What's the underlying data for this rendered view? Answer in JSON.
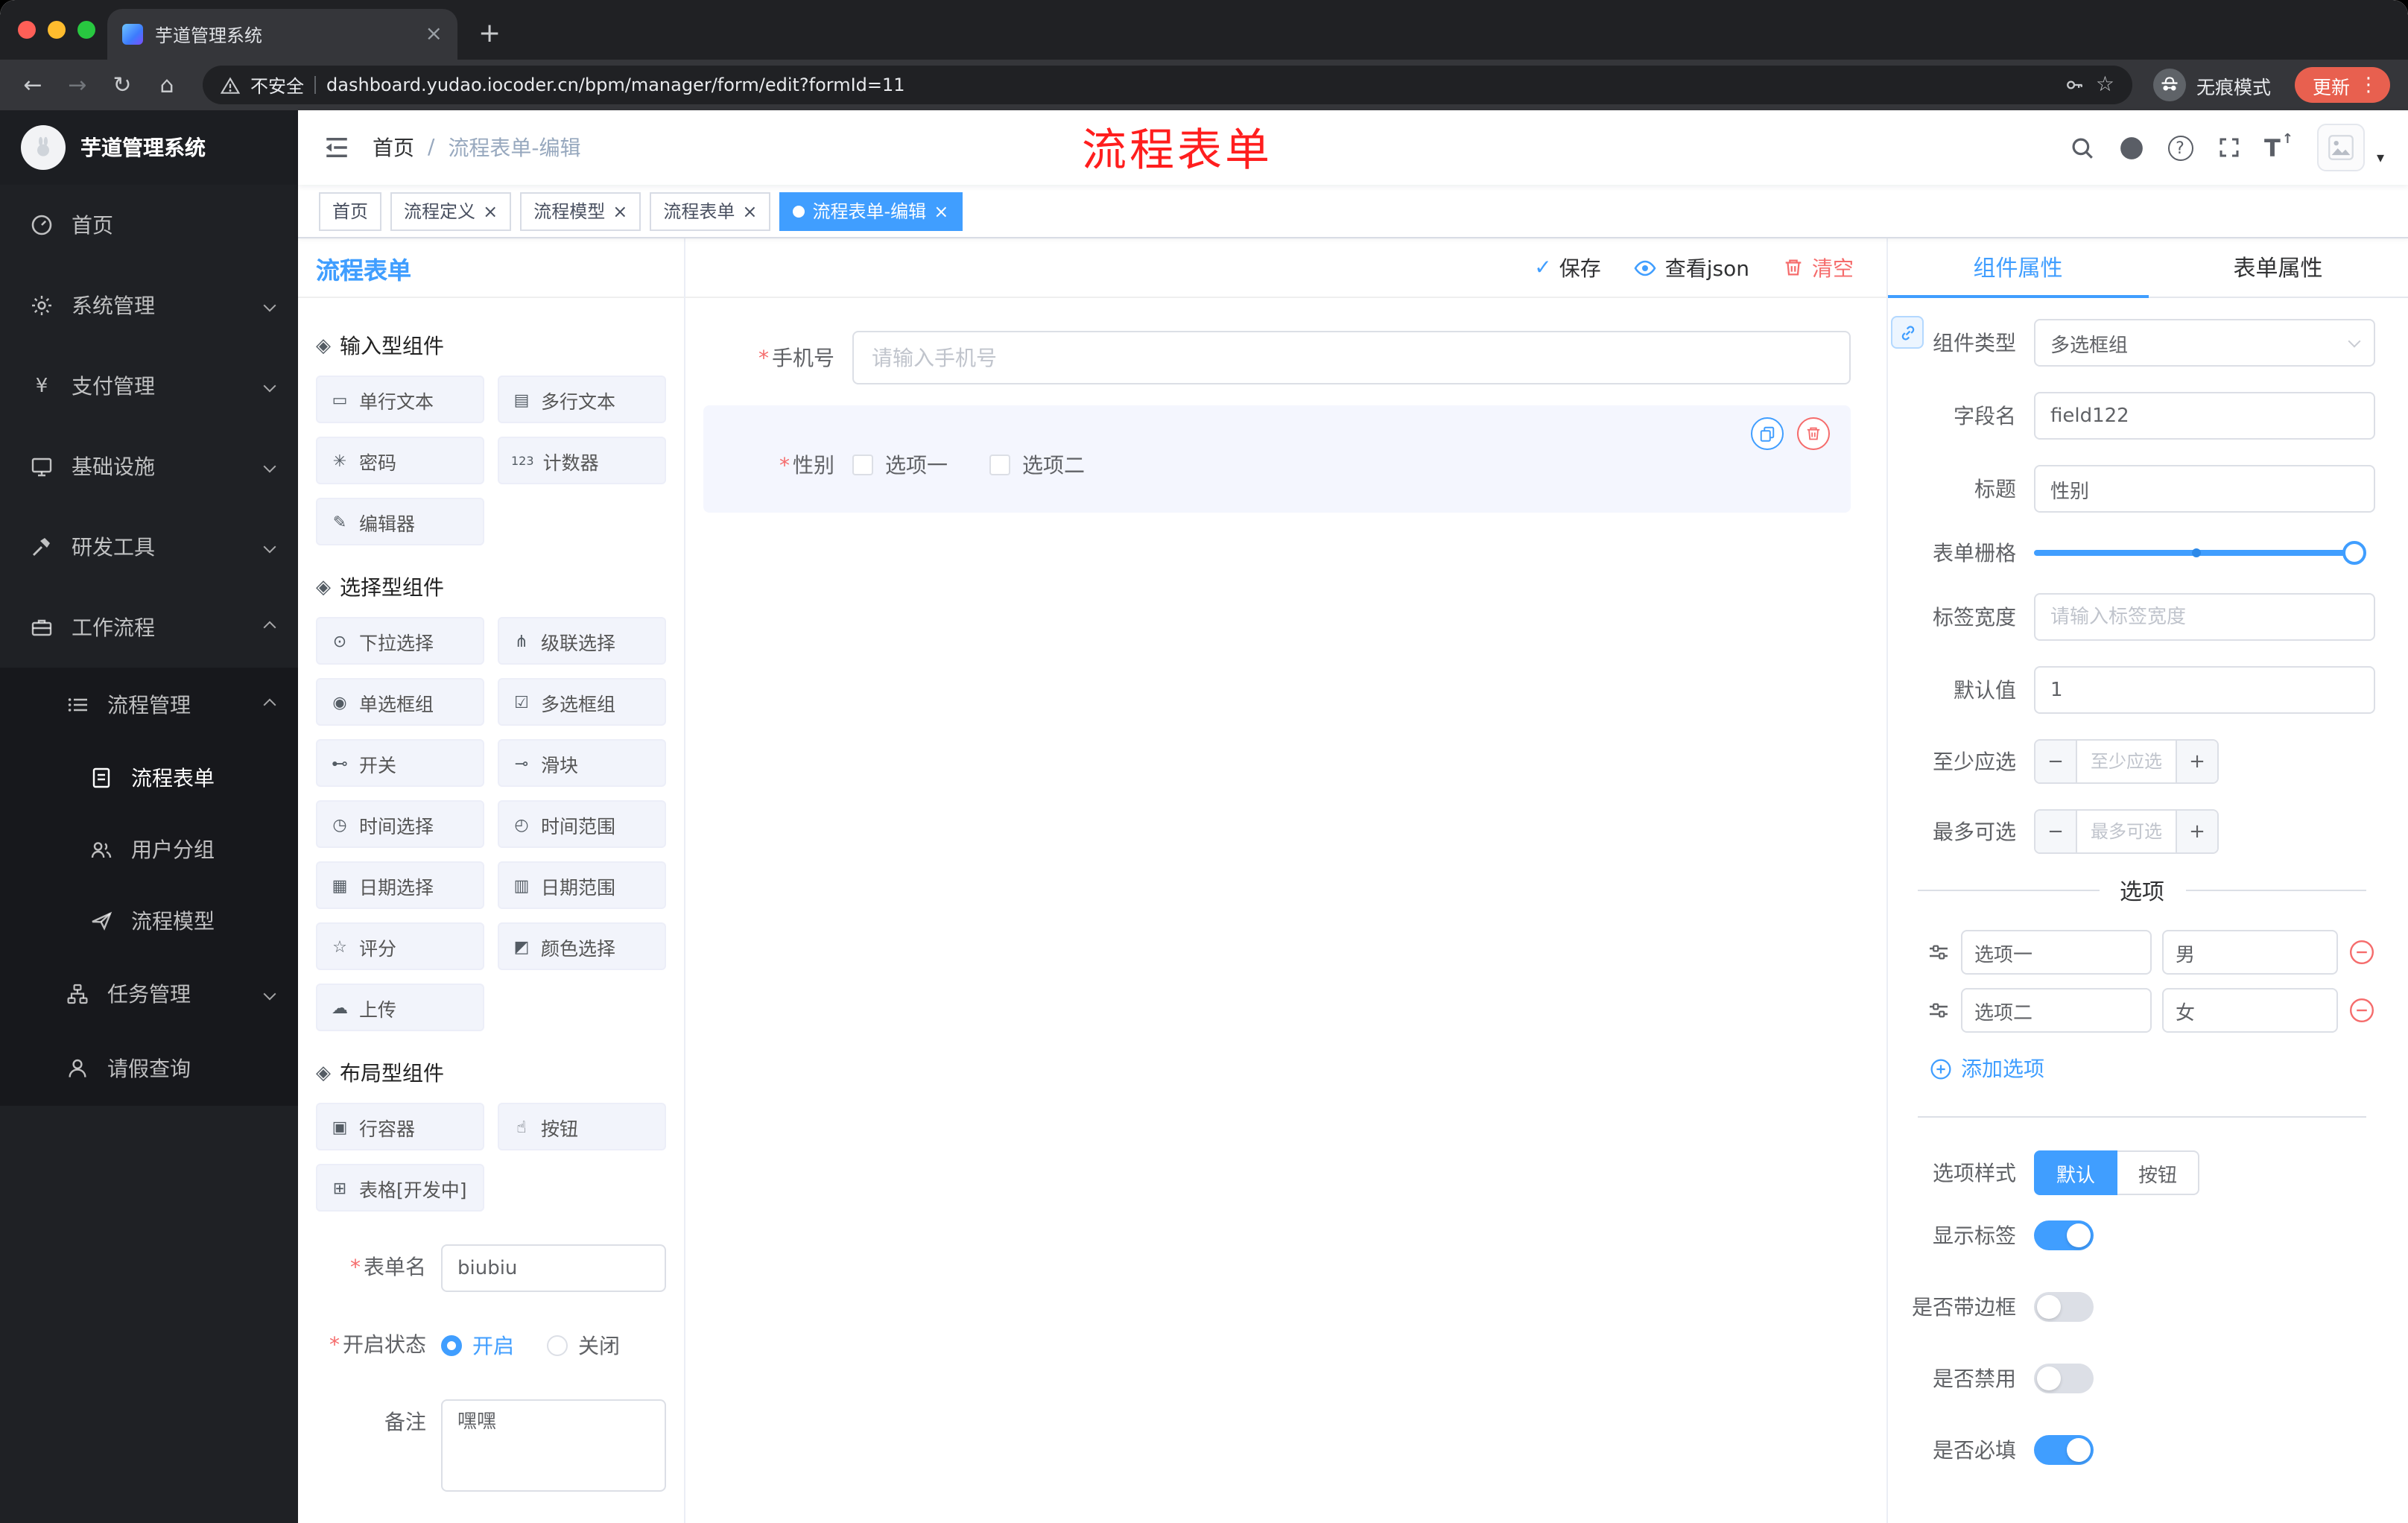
{
  "colors": {
    "primary": "#409eff",
    "danger": "#f56c6c",
    "sidebar_bg": "#1f2125",
    "annotation_red": "#ff1e1e",
    "update_chip": "#e8604f",
    "active_tag": "#409eff"
  },
  "icons": {
    "asterisk": "*",
    "close": "×",
    "plus": "+",
    "minus": "−",
    "dots": "⋮",
    "caret_down": "▾",
    "back": "←",
    "forward": "→",
    "reload": "↻",
    "home": "⌂",
    "star": "☆",
    "check": "✓",
    "question": "?",
    "text_size": "T",
    "up_arrow": "↑",
    "slash": "/"
  },
  "browser": {
    "tab_title": "芋道管理系统",
    "security_label": "不安全",
    "url": "dashboard.yudao.iocoder.cn/bpm/manager/form/edit?formId=11",
    "incognito_label": "无痕模式",
    "update_label": "更新"
  },
  "sidebar": {
    "brand": "芋道管理系统",
    "menu": {
      "home": "首页",
      "system": "系统管理",
      "payment": "支付管理",
      "infra": "基础设施",
      "devtools": "研发工具",
      "workflow": "工作流程",
      "process_mgmt": "流程管理",
      "process_form": "流程表单",
      "user_group": "用户分组",
      "process_model": "流程模型",
      "task_mgmt": "任务管理",
      "leave_query": "请假查询"
    }
  },
  "navbar": {
    "breadcrumb_home": "首页",
    "breadcrumb_current": "流程表单-编辑",
    "annotation": "流程表单"
  },
  "tags": [
    {
      "label": "首页",
      "active": false,
      "closable": false
    },
    {
      "label": "流程定义",
      "active": false,
      "closable": true
    },
    {
      "label": "流程模型",
      "active": false,
      "closable": true
    },
    {
      "label": "流程表单",
      "active": false,
      "closable": true
    },
    {
      "label": "流程表单-编辑",
      "active": true,
      "closable": true
    }
  ],
  "designer": {
    "panel_title": "流程表单",
    "toolbar": {
      "save": "保存",
      "view_json": "查看json",
      "clear": "清空"
    },
    "palette": {
      "groups": [
        {
          "title": "输入型组件",
          "items": [
            {
              "label": "单行文本",
              "icon": "▭"
            },
            {
              "label": "多行文本",
              "icon": "▤"
            },
            {
              "label": "密码",
              "icon": "✳"
            },
            {
              "label": "计数器",
              "icon": "123"
            },
            {
              "label": "编辑器",
              "icon": "✎"
            }
          ]
        },
        {
          "title": "选择型组件",
          "items": [
            {
              "label": "下拉选择",
              "icon": "⊙"
            },
            {
              "label": "级联选择",
              "icon": "⋔"
            },
            {
              "label": "单选框组",
              "icon": "◉"
            },
            {
              "label": "多选框组",
              "icon": "☑"
            },
            {
              "label": "开关",
              "icon": "⊷"
            },
            {
              "label": "滑块",
              "icon": "⊸"
            },
            {
              "label": "时间选择",
              "icon": "◷"
            },
            {
              "label": "时间范围",
              "icon": "◴"
            },
            {
              "label": "日期选择",
              "icon": "▦"
            },
            {
              "label": "日期范围",
              "icon": "▥"
            },
            {
              "label": "评分",
              "icon": "☆"
            },
            {
              "label": "颜色选择",
              "icon": "◩"
            },
            {
              "label": "上传",
              "icon": "☁"
            }
          ]
        },
        {
          "title": "布局型组件",
          "items": [
            {
              "label": "行容器",
              "icon": "▣"
            },
            {
              "label": "按钮",
              "icon": "☝"
            },
            {
              "label": "表格[开发中]",
              "icon": "⊞"
            }
          ]
        }
      ]
    },
    "meta": {
      "name_label": "表单名",
      "name_value": "biubiu",
      "status_label": "开启状态",
      "status_on": "开启",
      "status_off": "关闭",
      "remark_label": "备注",
      "remark_value": "嘿嘿"
    },
    "canvas": {
      "phone_label": "手机号",
      "phone_placeholder": "请输入手机号",
      "gender_label": "性别",
      "gender_option1": "选项一",
      "gender_option2": "选项二"
    }
  },
  "props": {
    "tab_component": "组件属性",
    "tab_form": "表单属性",
    "rows": {
      "type_label": "组件类型",
      "type_value": "多选框组",
      "field_label": "字段名",
      "field_value": "field122",
      "title_label": "标题",
      "title_value": "性别",
      "grid_label": "表单栅格",
      "label_width_label": "标签宽度",
      "label_width_placeholder": "请输入标签宽度",
      "default_label": "默认值",
      "default_value": "1",
      "min_label": "至少应选",
      "min_placeholder": "至少应选",
      "max_label": "最多可选",
      "max_placeholder": "最多可选"
    },
    "options_title": "选项",
    "options": [
      {
        "label": "选项一",
        "value": "男"
      },
      {
        "label": "选项二",
        "value": "女"
      }
    ],
    "add_option": "添加选项",
    "style_label": "选项样式",
    "style_default": "默认",
    "style_button": "按钮",
    "toggles": {
      "show_label": "显示标签",
      "border_label": "是否带边框",
      "disabled_label": "是否禁用",
      "required_label": "是否必填"
    }
  }
}
